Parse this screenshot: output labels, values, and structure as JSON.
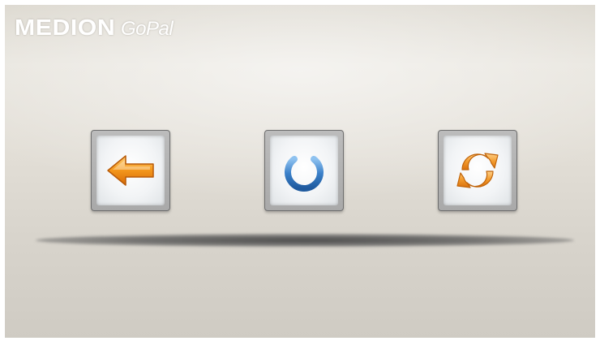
{
  "header": {
    "brand": "MEDION",
    "product": "GoPal"
  },
  "buttons": [
    {
      "name": "back",
      "icon": "back-arrow-icon",
      "color": "#f08a14"
    },
    {
      "name": "power",
      "icon": "power-icon",
      "color": "#3a7fc8"
    },
    {
      "name": "refresh",
      "icon": "refresh-icon",
      "color": "#f09a28"
    }
  ],
  "colors": {
    "background": "#e2ded6",
    "brand_text": "#ffffff",
    "button_frame": "#a9a9a9"
  }
}
